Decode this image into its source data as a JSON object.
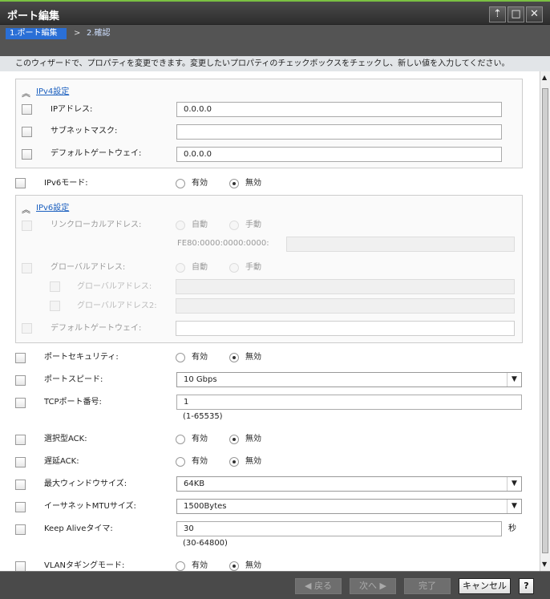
{
  "window": {
    "title": "ポート編集",
    "pin": "⇡",
    "max": "□",
    "close": "✕"
  },
  "wizard": {
    "step1": "1.ポート編集",
    "sep": ">",
    "step2": "2.確認"
  },
  "instruction": "このウィザードで、プロパティを変更できます。変更したいプロパティのチェックボックスをチェックし、新しい値を入力してください。",
  "ipv4": {
    "header": "IPv4設定",
    "ip_label": "IPアドレス:",
    "ip_value": "0.0.0.0",
    "mask_label": "サブネットマスク:",
    "mask_value": "",
    "gw_label": "デフォルトゲートウェイ:",
    "gw_value": "0.0.0.0"
  },
  "radio": {
    "on": "有効",
    "off": "無効",
    "auto": "自動",
    "manual": "手動"
  },
  "ipv6_mode": {
    "label": "IPv6モード:",
    "selected": "無効"
  },
  "ipv6": {
    "header": "IPv6設定",
    "link_local_label": "リンクローカルアドレス:",
    "link_prefix": "FE80:0000:0000:0000:",
    "global_label": "グローバルアドレス:",
    "global1_label": "グローバルアドレス:",
    "global2_label": "グローバルアドレス2:",
    "gw_label": "デフォルトゲートウェイ:"
  },
  "port_security": {
    "label": "ポートセキュリティ:",
    "selected": "無効"
  },
  "port_speed": {
    "label": "ポートスピード:",
    "value": "10 Gbps"
  },
  "tcp_port": {
    "label": "TCPポート番号:",
    "value": "1",
    "range": "(1-65535)"
  },
  "selective_ack": {
    "label": "選択型ACK:",
    "selected": "無効"
  },
  "delayed_ack": {
    "label": "遅延ACK:",
    "selected": "無効"
  },
  "window_size": {
    "label": "最大ウィンドウサイズ:",
    "value": "64KB"
  },
  "mtu": {
    "label": "イーサネットMTUサイズ:",
    "value": "1500Bytes"
  },
  "keep_alive": {
    "label": "Keep Aliveタイマ:",
    "value": "30",
    "unit": "秒",
    "range": "(30-64800)"
  },
  "vlan": {
    "label": "VLANタギングモード:",
    "selected": "無効"
  },
  "footer": {
    "back": "◀ 戻る",
    "next": "次へ ▶",
    "finish": "完了",
    "cancel": "キャンセル",
    "help": "?"
  }
}
